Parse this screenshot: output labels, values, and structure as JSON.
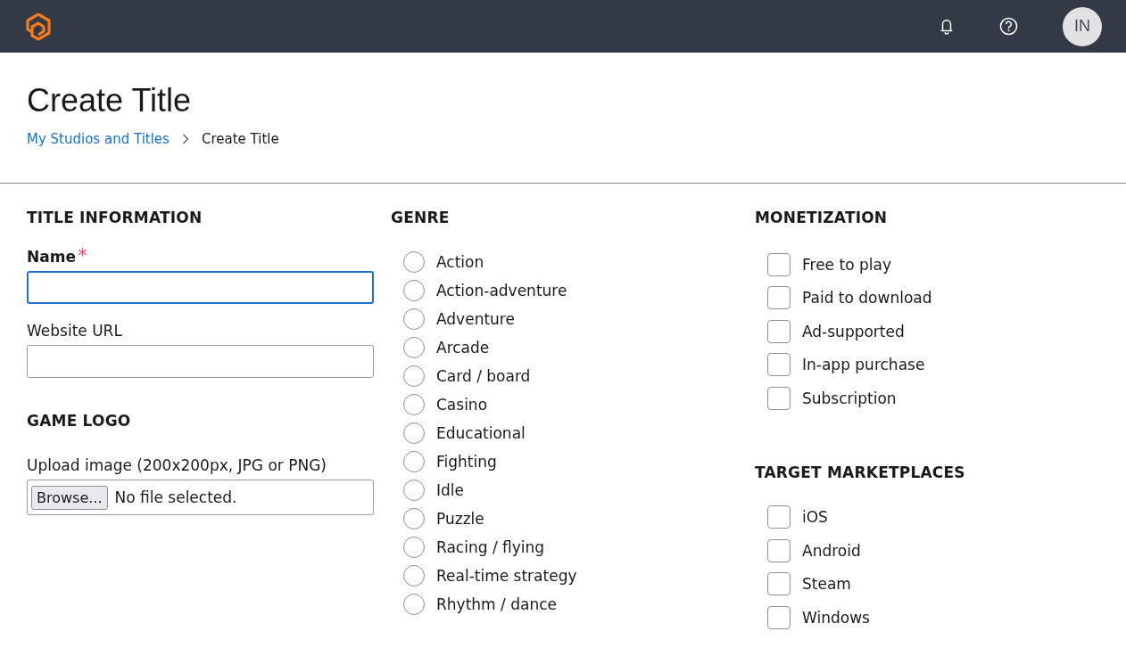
{
  "header": {
    "avatar": "IN"
  },
  "page": {
    "title": "Create Title",
    "breadcrumb": [
      {
        "label": "My Studios and Titles",
        "link": true
      },
      {
        "label": "Create Title",
        "link": false
      }
    ]
  },
  "title_information": {
    "heading": "TITLE INFORMATION",
    "fields": [
      {
        "label": "Name",
        "required_mark": "*",
        "focused": true
      },
      {
        "label": "Website URL",
        "focused": false
      }
    ]
  },
  "game_logo": {
    "heading": "GAME LOGO",
    "label": "Upload image (200x200px, JPG or PNG)",
    "button": "Browse...",
    "status": "No file selected."
  },
  "genre": {
    "heading": "GENRE",
    "options": [
      {
        "label": "Action",
        "selected": false
      },
      {
        "label": "Action-adventure",
        "selected": false
      },
      {
        "label": "Adventure",
        "selected": false
      },
      {
        "label": "Arcade",
        "selected": false
      },
      {
        "label": "Card / board",
        "selected": false
      },
      {
        "label": "Casino",
        "selected": false
      },
      {
        "label": "Educational",
        "selected": false
      },
      {
        "label": "Fighting",
        "selected": false
      },
      {
        "label": "Idle",
        "selected": false
      },
      {
        "label": "Puzzle",
        "selected": false
      },
      {
        "label": "Racing / flying",
        "selected": false
      },
      {
        "label": "Real-time strategy",
        "selected": false
      },
      {
        "label": "Rhythm / dance",
        "selected": false
      }
    ]
  },
  "monetization": {
    "heading": "MONETIZATION",
    "options": [
      {
        "label": "Free to play",
        "checked": false
      },
      {
        "label": "Paid to download",
        "checked": false
      },
      {
        "label": "Ad-supported",
        "checked": false
      },
      {
        "label": "In-app purchase",
        "checked": false
      },
      {
        "label": "Subscription",
        "checked": false
      }
    ]
  },
  "target_marketplaces": {
    "heading": "TARGET MARKETPLACES",
    "options": [
      {
        "label": "iOS",
        "checked": false
      },
      {
        "label": "Android",
        "checked": false
      },
      {
        "label": "Steam",
        "checked": false
      },
      {
        "label": "Windows",
        "checked": false
      }
    ]
  }
}
